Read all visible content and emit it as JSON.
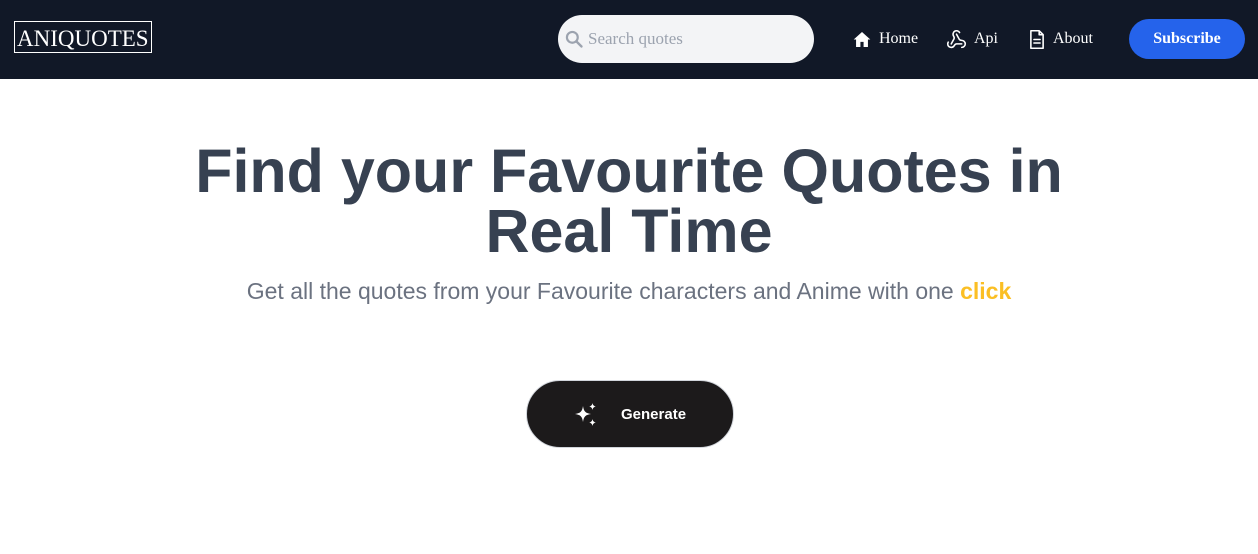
{
  "header": {
    "logo_text": "ANIQUOTES",
    "search": {
      "placeholder": "Search quotes",
      "value": "",
      "icon": "search-icon"
    },
    "nav": [
      {
        "label": "Home",
        "icon": "home-icon"
      },
      {
        "label": "Api",
        "icon": "webhook-icon"
      },
      {
        "label": "About",
        "icon": "document-icon"
      }
    ],
    "subscribe_label": "Subscribe"
  },
  "hero": {
    "title_line1": "Find your Favourite Quotes in",
    "title_line2": "Real Time",
    "subtitle_text": "Get all the quotes from your Favourite characters and Anime with one",
    "subtitle_accent": "click",
    "generate_label": "Generate",
    "generate_icon": "sparkles-icon"
  },
  "colors": {
    "navbar_bg": "#111827",
    "subscribe_bg": "#2563eb",
    "title_text": "#374151",
    "subtitle_text": "#6b7280",
    "accent": "#fbbf24",
    "generate_bg": "#1c1a1b"
  }
}
